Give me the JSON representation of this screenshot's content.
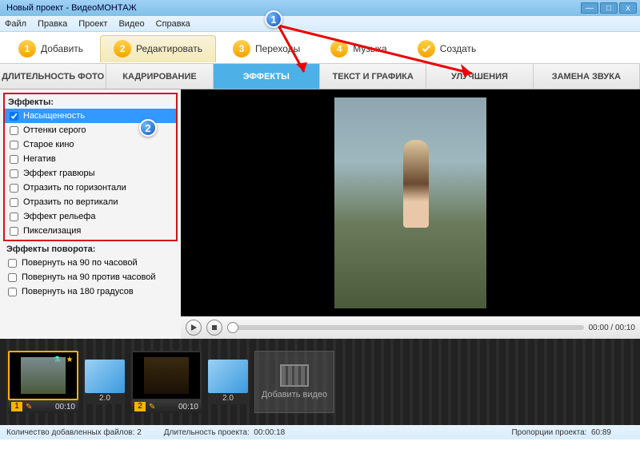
{
  "window": {
    "title": "Новый проект - ВидеоМОНТАЖ"
  },
  "menu": {
    "file": "Файл",
    "edit": "Правка",
    "project": "Проект",
    "video": "Видео",
    "help": "Справка"
  },
  "maintabs": {
    "add": "Добавить",
    "edit": "Редактировать",
    "transitions": "Переходы",
    "music": "Музыка",
    "create": "Создать"
  },
  "subtabs": {
    "duration": "ДЛИТЕЛЬНОСТЬ ФОТО",
    "crop": "КАДРИРОВАНИЕ",
    "effects": "ЭФФЕКТЫ",
    "text": "ТЕКСТ И ГРАФИКА",
    "enhance": "УЛУЧШЕНИЯ",
    "audio": "ЗАМЕНА ЗВУКА"
  },
  "effects": {
    "title": "Эффекты:",
    "items": [
      {
        "label": "Насыщенность",
        "checked": true,
        "selected": true
      },
      {
        "label": "Оттенки серого",
        "checked": false
      },
      {
        "label": "Старое кино",
        "checked": false
      },
      {
        "label": "Негатив",
        "checked": false
      },
      {
        "label": "Эффект гравюры",
        "checked": false
      },
      {
        "label": "Отразить по горизонтали",
        "checked": false
      },
      {
        "label": "Отразить по вертикали",
        "checked": false
      },
      {
        "label": "Эффект рельефа",
        "checked": false
      },
      {
        "label": "Пикселизация",
        "checked": false
      }
    ],
    "rotation_title": "Эффекты поворота:",
    "rotation_items": [
      {
        "label": "Повернуть на 90 по часовой",
        "checked": false
      },
      {
        "label": "Повернуть на 90 против часовой",
        "checked": false
      },
      {
        "label": "Повернуть на 180 градусов",
        "checked": false
      }
    ]
  },
  "player": {
    "time": "00:00 / 00:10"
  },
  "timeline": {
    "clips": [
      {
        "index": "1",
        "duration": "00:10",
        "selected": true
      },
      {
        "index": "2",
        "duration": "00:10",
        "selected": false
      }
    ],
    "transitions": [
      {
        "duration": "2.0"
      },
      {
        "duration": "2.0"
      }
    ],
    "add_video": "Добавить видео"
  },
  "status": {
    "files_count_label": "Количество добавленных файлов:",
    "files_count": "2",
    "duration_label": "Длительность проекта:",
    "duration": "00:00:18",
    "ratio_label": "Пропорции проекта:",
    "ratio": "60:89"
  },
  "callouts": {
    "one": "1",
    "two": "2"
  }
}
